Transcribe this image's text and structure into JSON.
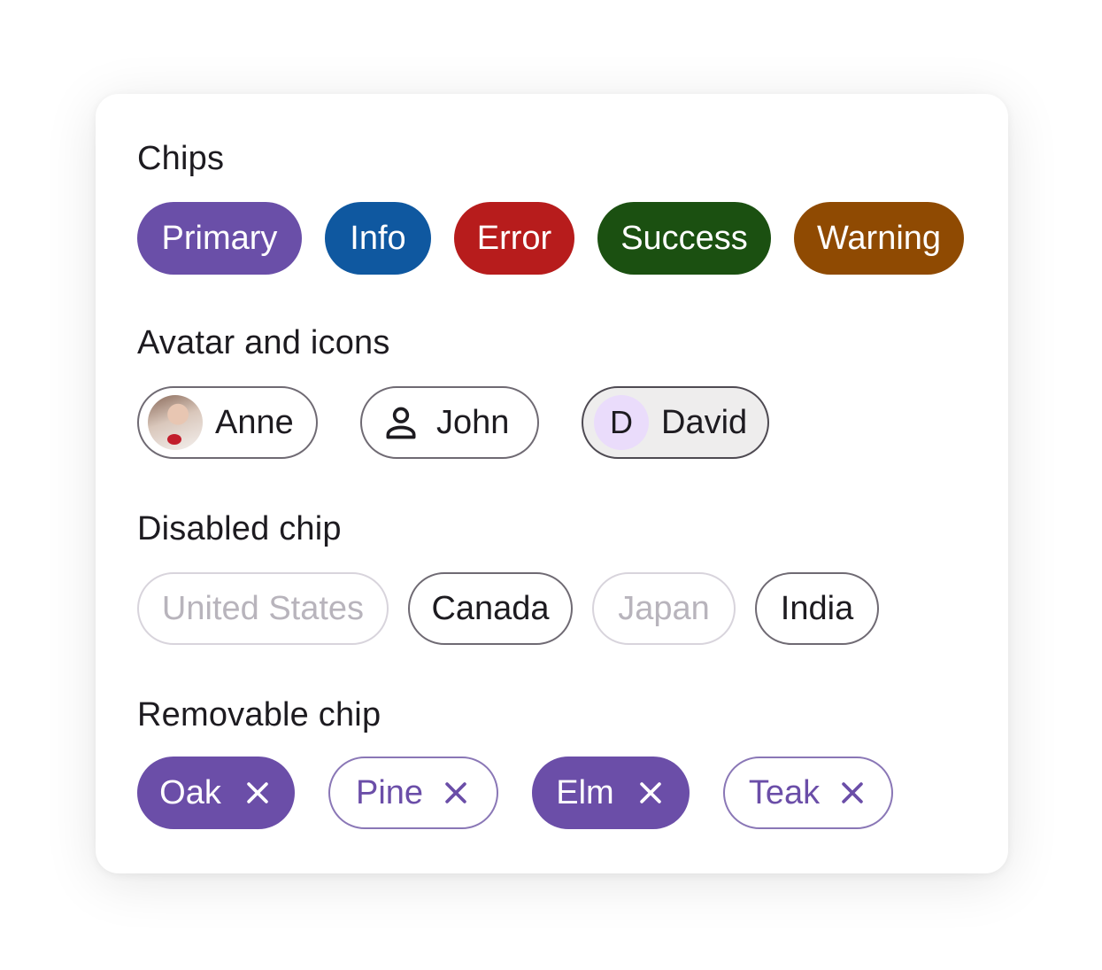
{
  "sections": {
    "chips": {
      "title": "Chips",
      "items": [
        {
          "label": "Primary",
          "color": "#6a4fa8"
        },
        {
          "label": "Info",
          "color": "#0f58a0"
        },
        {
          "label": "Error",
          "color": "#b71c1c"
        },
        {
          "label": "Success",
          "color": "#1b5011"
        },
        {
          "label": "Warning",
          "color": "#8f4a02"
        }
      ]
    },
    "avatar_icons": {
      "title": "Avatar and icons",
      "items": [
        {
          "label": "Anne",
          "avatar": "photo"
        },
        {
          "label": "John",
          "icon": "person-icon"
        },
        {
          "label": "David",
          "avatar_letter": "D",
          "selected": true
        }
      ]
    },
    "disabled": {
      "title": "Disabled chip",
      "items": [
        {
          "label": "United States",
          "disabled": true
        },
        {
          "label": "Canada",
          "disabled": false
        },
        {
          "label": "Japan",
          "disabled": true
        },
        {
          "label": "India",
          "disabled": false
        }
      ]
    },
    "removable": {
      "title": "Removable chip",
      "items": [
        {
          "label": "Oak",
          "style": "filled"
        },
        {
          "label": "Pine",
          "style": "outlined"
        },
        {
          "label": "Elm",
          "style": "filled"
        },
        {
          "label": "Teak",
          "style": "outlined"
        }
      ]
    }
  }
}
